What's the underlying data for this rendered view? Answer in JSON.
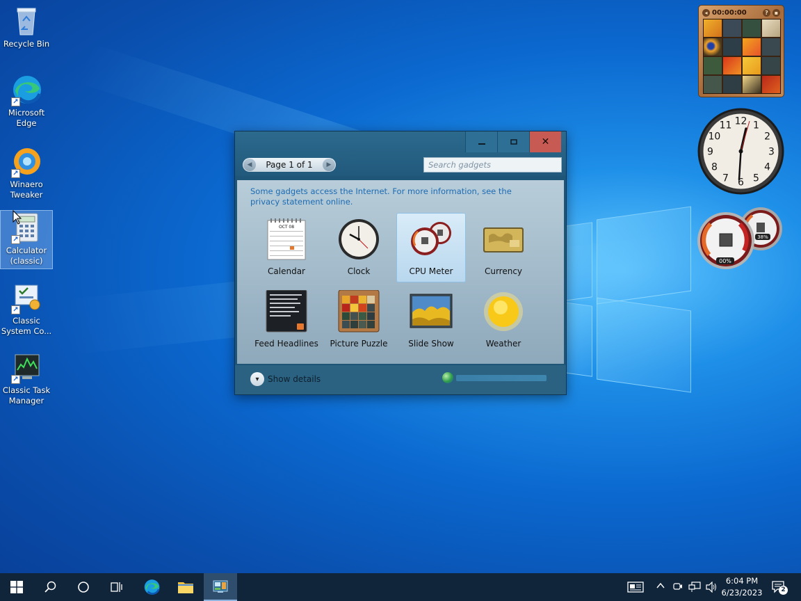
{
  "desktop": {
    "icons": [
      {
        "label": "Recycle Bin"
      },
      {
        "label": "Microsoft Edge"
      },
      {
        "label": "Winaero Tweaker"
      },
      {
        "label": "Calculator (classic)"
      },
      {
        "label": "Classic System Co..."
      },
      {
        "label": "Classic Task Manager"
      }
    ]
  },
  "gadget_window": {
    "minimize_icon": "minimize-icon",
    "maximize_icon": "maximize-icon",
    "close_label": "✕",
    "pager_label": "Page 1 of 1",
    "search_placeholder": "Search gadgets",
    "notice": "Some gadgets access the Internet.  For more information, see the privacy statement online.",
    "gadgets": [
      {
        "label": "Calendar"
      },
      {
        "label": "Clock"
      },
      {
        "label": "CPU Meter"
      },
      {
        "label": "Currency"
      },
      {
        "label": "Feed Headlines"
      },
      {
        "label": "Picture Puzzle"
      },
      {
        "label": "Slide Show"
      },
      {
        "label": "Weather"
      }
    ],
    "calendar_month": "OCT 08",
    "show_details": "Show details"
  },
  "side_gadgets": {
    "puzzle_timer": "00:00:00",
    "puzzle_help": "?",
    "cpu_percent": "00%",
    "memory_percent": "38%",
    "clock_numbers": [
      "12",
      "1",
      "2",
      "3",
      "4",
      "5",
      "6",
      "7",
      "8",
      "9",
      "10",
      "11"
    ]
  },
  "taskbar": {
    "time": "6:04 PM",
    "date": "6/23/2023",
    "notification_count": "2"
  },
  "colors": {
    "window_frame": "#1f5677",
    "close_button": "#c75a52",
    "taskbar": "#10243a"
  }
}
